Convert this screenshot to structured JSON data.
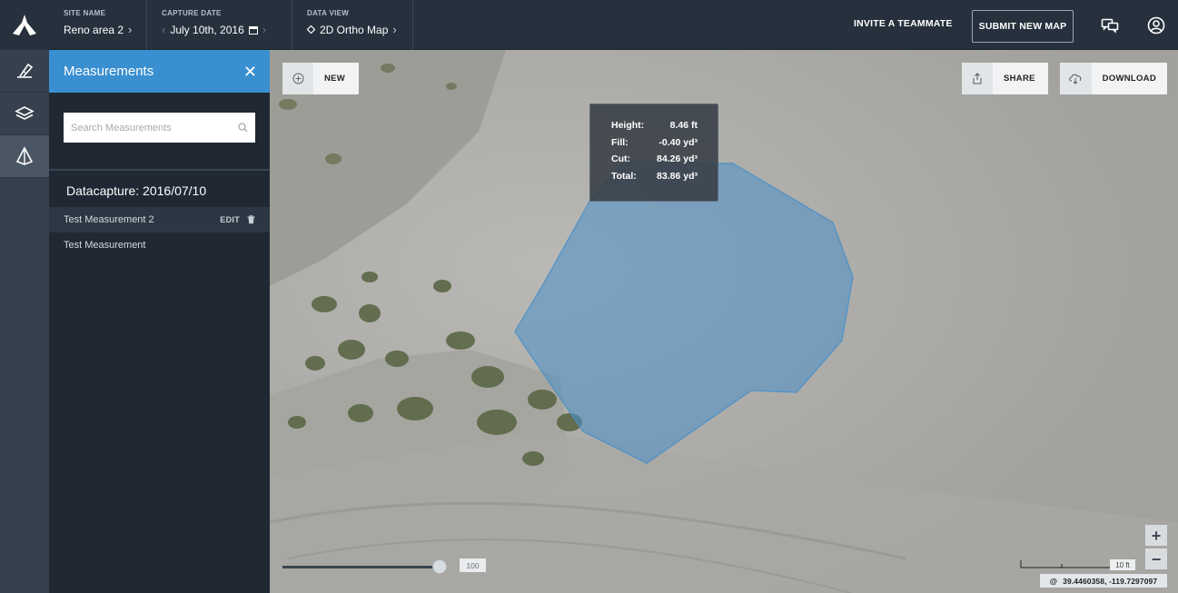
{
  "header": {
    "site_name_label": "SITE NAME",
    "site_name_value": "Reno area 2",
    "capture_date_label": "CAPTURE DATE",
    "capture_date_value": "July 10th, 2016",
    "data_view_label": "DATA VIEW",
    "data_view_value": "2D Ortho Map",
    "invite_label": "INVITE A TEAMMATE",
    "submit_label": "SUBMIT NEW MAP"
  },
  "rail": {
    "items": [
      "measure-tool",
      "layers",
      "measurements"
    ]
  },
  "panel": {
    "title": "Measurements",
    "search_placeholder": "Search Measurements",
    "group_title": "Datacapture: 2016/07/10",
    "items": [
      {
        "label": "Test Measurement 2",
        "edit_label": "EDIT",
        "selected": true
      },
      {
        "label": "Test Measurement",
        "selected": false
      }
    ]
  },
  "map": {
    "new_label": "NEW",
    "share_label": "SHARE",
    "download_label": "DOWNLOAD",
    "tooltip": [
      {
        "key": "Height:",
        "value": "8.46 ft"
      },
      {
        "key": "Fill:",
        "value": "-0.40 yd³"
      },
      {
        "key": "Cut:",
        "value": "84.26 yd³"
      },
      {
        "key": "Total:",
        "value": "83.86 yd³"
      }
    ],
    "opacity_value": "100",
    "opacity_level": 1.0,
    "scale_label": "10 ft",
    "coordinates": "39.4460358,  -119.7297097",
    "zoom_in": "+",
    "zoom_out": "−",
    "polygon_color": "#4a90c8"
  },
  "colors": {
    "accent": "#3a8fd0",
    "topbar": "#26313d",
    "panel": "#1f2833"
  }
}
